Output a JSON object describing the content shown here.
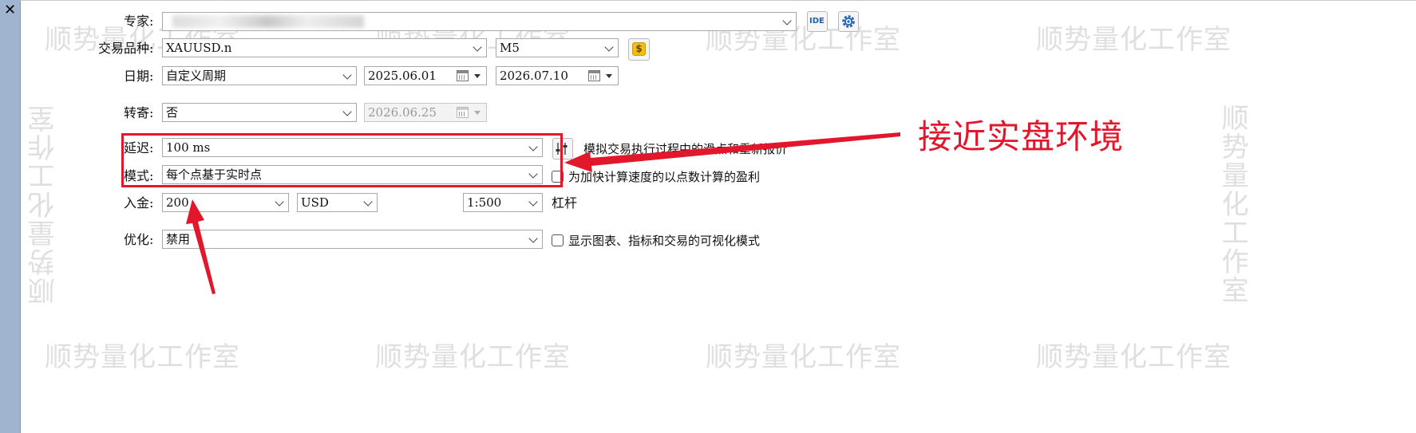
{
  "window": {
    "close_glyph": "✕"
  },
  "watermark": {
    "text": "顺势量化工作室"
  },
  "form": {
    "expert": {
      "label": "专家:",
      "ide_label": "IDE"
    },
    "symbol": {
      "label": "交易品种:",
      "value": "XAUUSD.n",
      "timeframe": "M5"
    },
    "date": {
      "label": "日期:",
      "period": "自定义周期",
      "from": "2025.06.01",
      "to": "2026.07.10"
    },
    "forward": {
      "label": "转寄:",
      "value": "否",
      "date": "2026.06.25"
    },
    "delay": {
      "label": "延迟:",
      "value": "100 ms",
      "note": "模拟交易执行过程中的滑点和重新报价"
    },
    "mode": {
      "label": "模式:",
      "value": "每个点基于实时点",
      "checkbox_label": "为加快计算速度的以点数计算的盈利"
    },
    "deposit": {
      "label": "入金:",
      "value": "200",
      "currency": "USD",
      "leverage": "1:500",
      "leverage_label": "杠杆"
    },
    "optimization": {
      "label": "优化:",
      "value": "禁用",
      "checkbox_label": "显示图表、指标和交易的可视化模式"
    }
  },
  "annotation": {
    "callout": "接近实盘环境",
    "color": "#e3172b"
  }
}
